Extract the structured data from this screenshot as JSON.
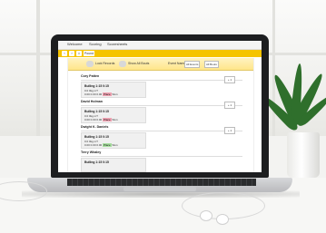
{
  "topbar": {
    "items": [
      "Welcome",
      "Scoring",
      "Scoresheets"
    ]
  },
  "toolbar": {
    "field_value": "Pound"
  },
  "filterbar": {
    "toggle1_label": "Lock Records",
    "toggle2_label": "Show All Bouts",
    "scoring_label": "Event Name",
    "select1_value": "All Events",
    "select2_value": "All Bouts"
  },
  "sections": [
    {
      "title": "Cory Patten",
      "card": {
        "line1": "Bulling 1:15 0:15",
        "line2": "0.0   0kg   mT",
        "line3": "0.00  0.00  0.00",
        "pill": "Place",
        "pill_after": "Won"
      }
    },
    {
      "title": "David Holman",
      "card": {
        "line1": "Bulling 1:15 0:15",
        "line2": "0.0   0kg   mT",
        "line3": "0.00  0.00  0.00",
        "pill": "Place",
        "pill_after": "Won"
      }
    },
    {
      "title": "Dwight K. Daniels",
      "card": {
        "line1": "Bulling 1:15 0:15",
        "line2": "0.0   0kg   mT",
        "line3": "0.00  0.00  0.00",
        "pill": "Place",
        "pill_after": "Won"
      }
    },
    {
      "title": "Terry Whaley",
      "card": {
        "line1": "Bulling 1:15 0:15",
        "line2": "",
        "line3": "",
        "pill": "",
        "pill_after": ""
      }
    }
  ],
  "side_button_label": "+ 1"
}
